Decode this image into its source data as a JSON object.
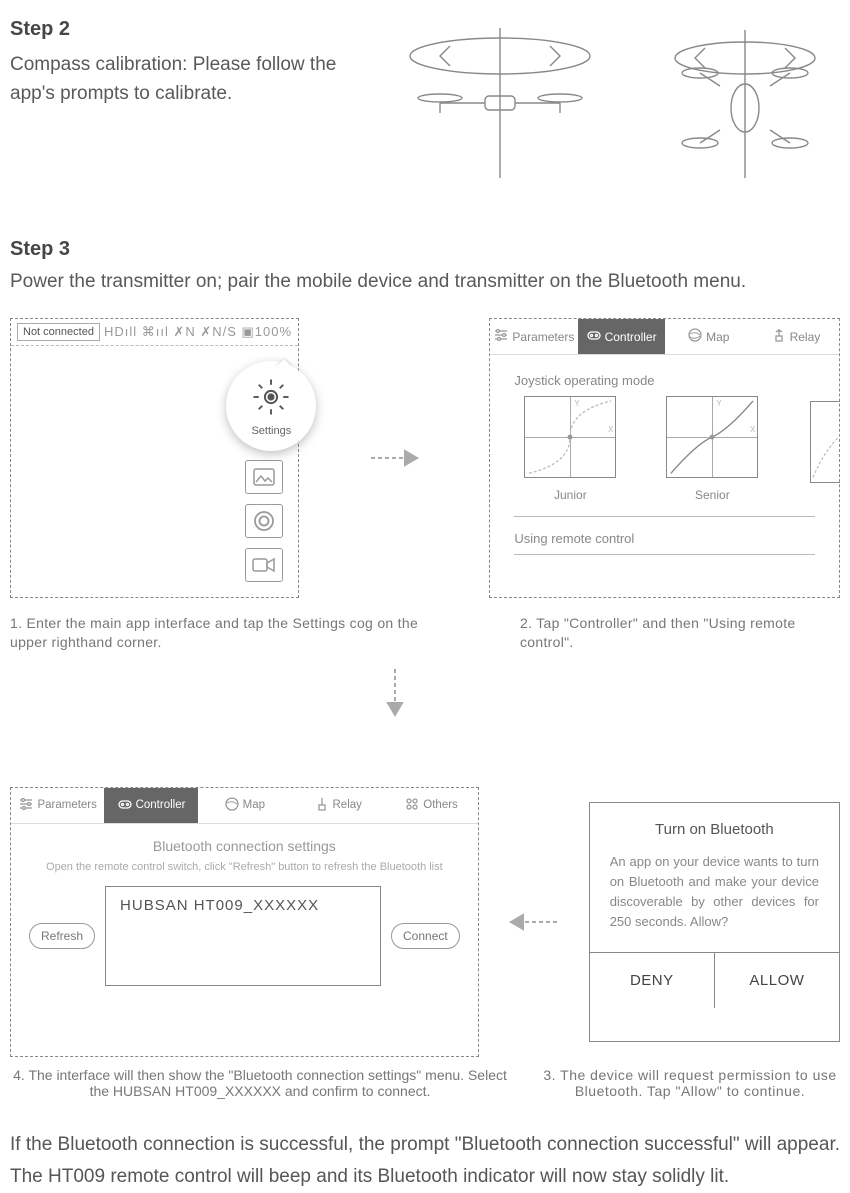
{
  "step2": {
    "title": "Step 2",
    "body": "Compass calibration: Please follow the app's prompts to calibrate."
  },
  "step3": {
    "title": "Step 3",
    "body": "Power the transmitter on; pair the mobile device and transmitter on the Bluetooth menu."
  },
  "panel1": {
    "not_connected": "Not connected",
    "stats": "HDıll  ⌘ııl  ✗N  ✗N/S  ▣100%",
    "settings_label": "Settings"
  },
  "panel2": {
    "tabs": {
      "parameters": "Parameters",
      "controller": "Controller",
      "map": "Map",
      "relay": "Relay"
    },
    "joystick_label": "Joystick operating mode",
    "junior": "Junior",
    "senior": "Senior",
    "using_remote": "Using remote control"
  },
  "captions": {
    "c1": "1. Enter the main app interface and tap the Settings cog on the upper righthand corner.",
    "c2": "2. Tap \"Controller\" and then \"Using remote control\".",
    "c3": "4. The interface will then show the \"Bluetooth connection settings\" menu. Select the HUBSAN HT009_XXXXXX and confirm to connect.",
    "c4": "3. The device will request permission to use Bluetooth. Tap \"Allow\" to continue."
  },
  "panel3": {
    "tabs": {
      "parameters": "Parameters",
      "controller": "Controller",
      "map": "Map",
      "relay": "Relay",
      "others": "Others"
    },
    "bt_title": "Bluetooth connection settings",
    "bt_sub": "Open the remote control switch, click \"Refresh\" button to refresh the Bluetooth list",
    "refresh": "Refresh",
    "connect": "Connect",
    "device": "HUBSAN HT009_XXXXXX"
  },
  "panel4": {
    "title": "Turn on Bluetooth",
    "text": "An app on your device wants to turn on Bluetooth and make your device discoverable by other devices for 250 seconds. Allow?",
    "deny": "DENY",
    "allow": "ALLOW"
  },
  "final": "If the Bluetooth connection is successful, the prompt \"Bluetooth connection successful\" will appear. The HT009 remote control will beep and its Bluetooth indicator will now stay solidly lit."
}
